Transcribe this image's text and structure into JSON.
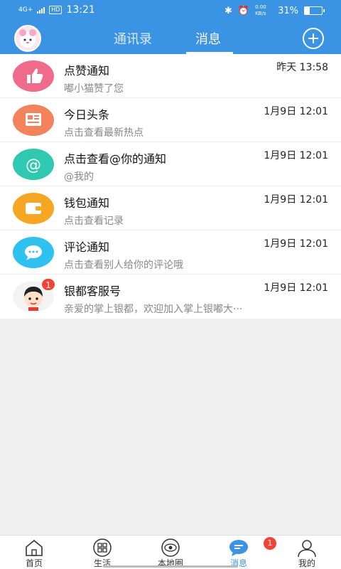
{
  "status_bar": {
    "network": "4G+",
    "hd": "HD",
    "time": "13:21",
    "data_speed": "0.00 KB/s",
    "battery": "31%",
    "battery_fraction": 0.31
  },
  "nav": {
    "tabs": [
      {
        "label": "通讯录",
        "active": false
      },
      {
        "label": "消息",
        "active": true
      }
    ]
  },
  "messages": [
    {
      "title": "点赞通知",
      "subtitle": "嘟小猫赞了您",
      "time": "昨天 13:58",
      "icon": "thumbs-up-icon",
      "color": "#f06a8c"
    },
    {
      "title": "今日头条",
      "subtitle": "点击查看最新热点",
      "time": "1月9日 12:01",
      "icon": "newspaper-icon",
      "color": "#f2835a"
    },
    {
      "title": "点击查看@你的通知",
      "subtitle": "@我的",
      "time": "1月9日 12:01",
      "icon": "at-sign-icon",
      "color": "#2ec9b0"
    },
    {
      "title": "钱包通知",
      "subtitle": "点击查看记录",
      "time": "1月9日 12:01",
      "icon": "wallet-icon",
      "color": "#f5a623"
    },
    {
      "title": "评论通知",
      "subtitle": "点击查看别人给你的评论哦",
      "time": "1月9日 12:01",
      "icon": "comment-bubble-icon",
      "color": "#2fc1f0"
    },
    {
      "title": "银都客服号",
      "subtitle": "亲爱的掌上银都，欢迎加入掌上银嘟大···",
      "time": "1月9日 12:01",
      "icon": "service-avatar",
      "color": "#ffffff",
      "badge": "1"
    }
  ],
  "bottom_nav": [
    {
      "label": "首页",
      "icon": "home-icon",
      "active": false
    },
    {
      "label": "生活",
      "icon": "grid-icon",
      "active": false
    },
    {
      "label": "本地圈",
      "icon": "eye-icon",
      "active": false
    },
    {
      "label": "消息",
      "icon": "chat-icon",
      "active": true,
      "badge": "1"
    },
    {
      "label": "我的",
      "icon": "person-icon",
      "active": false
    }
  ]
}
